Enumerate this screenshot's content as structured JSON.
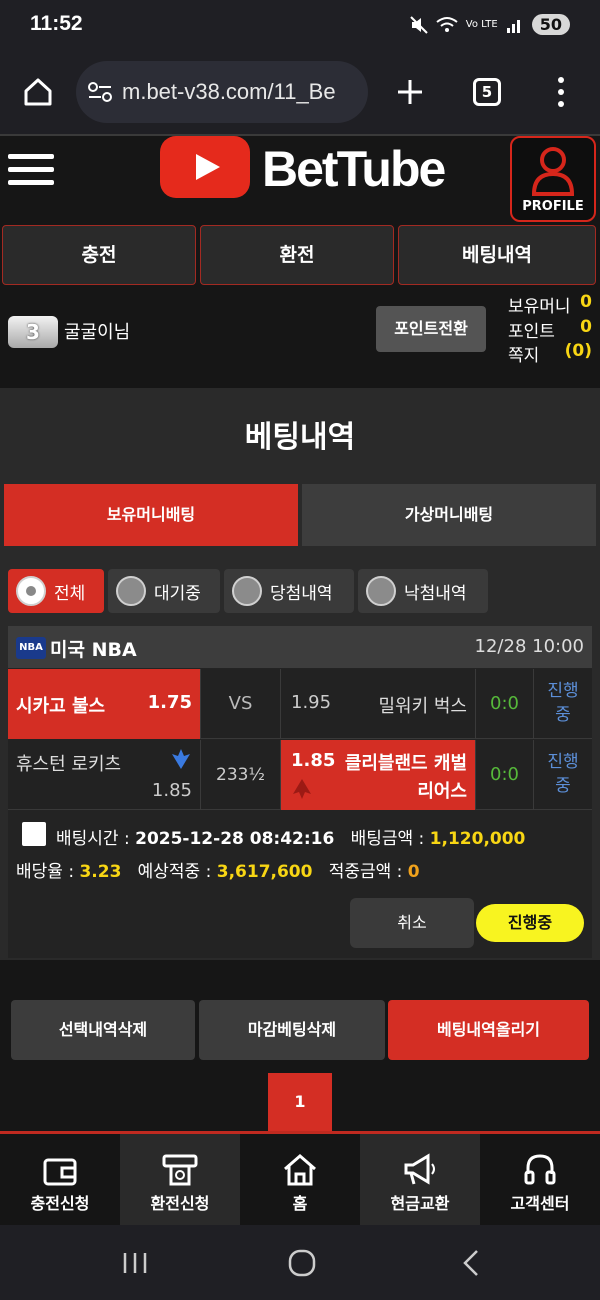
{
  "status_bar": {
    "time": "11:52",
    "signal_text": "Vo LTE",
    "battery": "50"
  },
  "browser": {
    "url": "m.bet-v38.com/11_Be",
    "tab_count": "5"
  },
  "header": {
    "logo_text": "BetTube",
    "profile_label": "PROFILE"
  },
  "top_buttons": [
    "충전",
    "환전",
    "베팅내역"
  ],
  "user": {
    "level": "3",
    "name": "굴굴이님",
    "point_convert_label": "포인트전환",
    "money_label": "보유머니",
    "money_value": "0",
    "point_label": "포인트",
    "point_value": "0",
    "message_label": "쪽지",
    "message_value": "(0)"
  },
  "section": {
    "title": "베팅내역",
    "main_tabs": [
      "보유머니배팅",
      "가상머니배팅"
    ],
    "filters": [
      "전체",
      "대기중",
      "당첨내역",
      "낙첨내역"
    ]
  },
  "game": {
    "league_logo": "NBA",
    "league": "미국 NBA",
    "datetime": "12/28 10:00",
    "rows": [
      {
        "home": "시카고 불스",
        "home_odds": "1.75",
        "mid": "VS",
        "away_odds": "1.95",
        "away": "밀워키 벅스",
        "score": "0:0",
        "status": "진행중"
      },
      {
        "home": "휴스턴 로키츠",
        "home_odds": "1.85",
        "mid": "233½",
        "away_odds": "1.85",
        "away": "클리블랜드 캐벌리어스",
        "score": "0:0",
        "status": "진행중"
      }
    ],
    "bet_time_label": "배팅시간 :",
    "bet_time": "2025-12-28 08:42:16",
    "bet_amount_label": "배팅금액 :",
    "bet_amount": "1,120,000",
    "odds_label": "배당율 :",
    "odds": "3.23",
    "expected_label": "예상적중 :",
    "expected": "3,617,600",
    "win_label": "적중금액 :",
    "win": "0",
    "cancel_label": "취소",
    "progress_label": "진행중"
  },
  "actions": [
    "선택내역삭제",
    "마감베팅삭제",
    "베팅내역올리기"
  ],
  "pagination": {
    "current": "1"
  },
  "bottom_nav": [
    "충전신청",
    "환전신청",
    "홈",
    "현금교환",
    "고객센터"
  ],
  "colors": {
    "accent_red": "#d42e24",
    "highlight_yellow": "#f8d614",
    "status_blue": "#5c8fd8",
    "score_green": "#56b83a"
  }
}
